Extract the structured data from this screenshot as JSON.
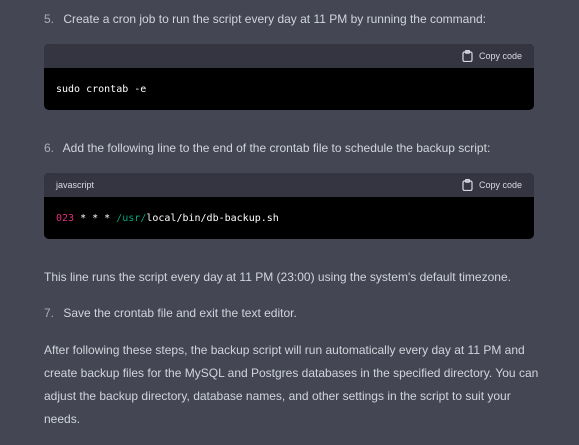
{
  "steps": [
    {
      "number": "5.",
      "text": "Create a cron job to run the script every day at 11 PM by running the command:"
    },
    {
      "number": "6.",
      "text": "Add the following line to the end of the crontab file to schedule the backup script:"
    },
    {
      "number": "7.",
      "text": "Save the crontab file and exit the text editor."
    }
  ],
  "code_blocks": [
    {
      "language": "",
      "copy_label": "Copy code",
      "code": "sudo crontab -e"
    },
    {
      "language": "javascript",
      "copy_label": "Copy code",
      "tokens": {
        "n1": "0",
        "n2": "23",
        "stars": " * * * ",
        "path1": "/usr/",
        "path2": "local/bin/db-backup.sh"
      }
    }
  ],
  "paragraphs": {
    "after_code": "This line runs the script every day at 11 PM (23:00) using the system's default timezone.",
    "summary": "After following these steps, the backup script will run automatically every day at 11 PM and create backup files for the MySQL and Postgres databases in the specified directory. You can adjust the backup directory, database names, and other settings in the script to suit your needs."
  },
  "colors": {
    "background": "#444654",
    "code_header": "#343541",
    "code_body": "#000000",
    "keyword_number": "#df3079",
    "path": "#00a67d"
  },
  "icons": {
    "copy": "clipboard-icon"
  }
}
